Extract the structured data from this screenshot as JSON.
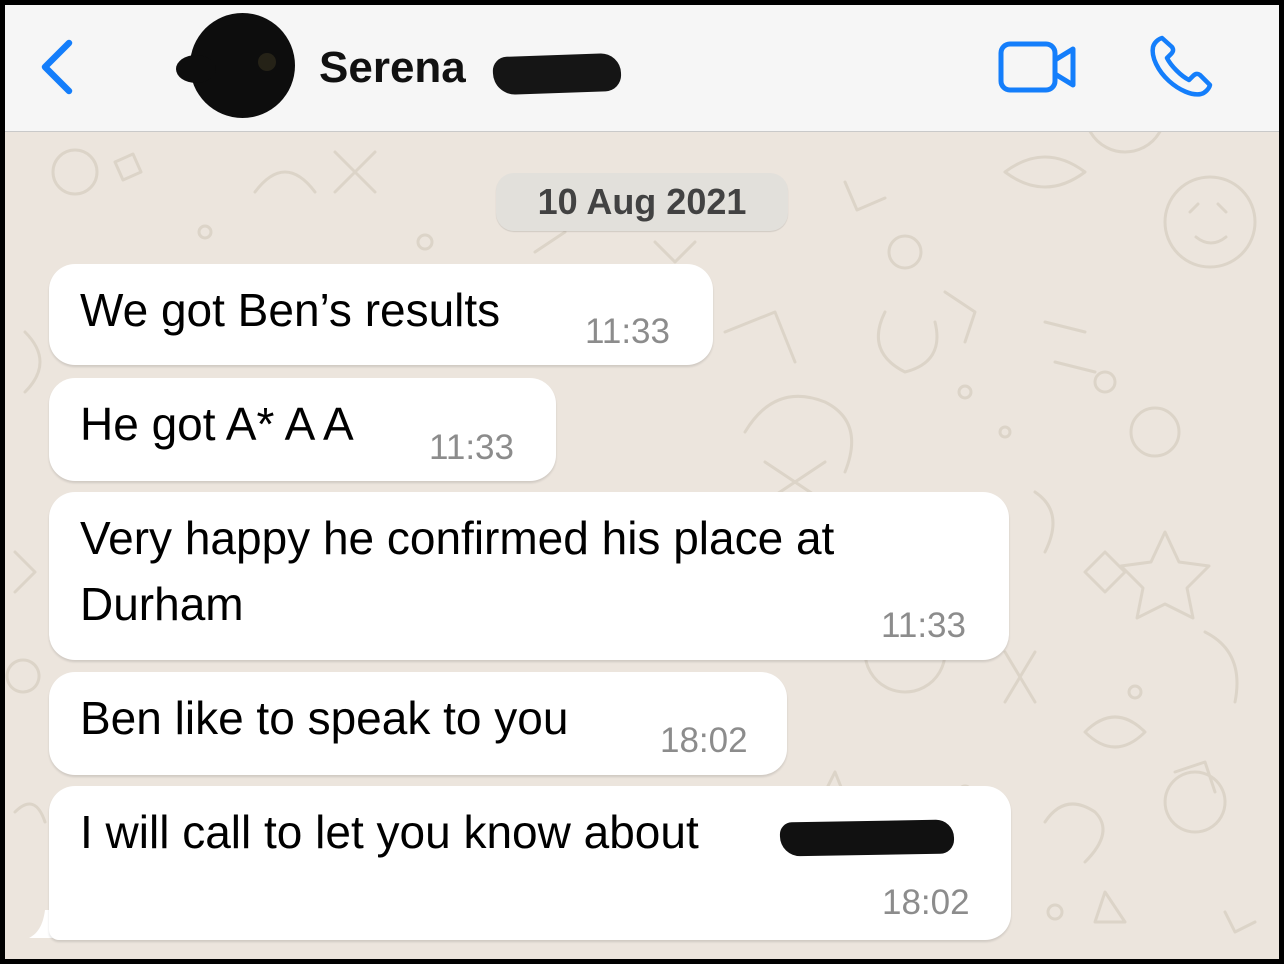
{
  "header": {
    "contact_name": "Serena"
  },
  "date_separator": "10 Aug 2021",
  "messages": [
    {
      "text": "We got Ben’s results",
      "time": "11:33"
    },
    {
      "text": "He got A* A A",
      "time": "11:33"
    },
    {
      "text_line1": "Very happy he confirmed his place at",
      "text_line2": "Durham",
      "time": "11:33"
    },
    {
      "text": "Ben like to speak to you",
      "time": "18:02"
    },
    {
      "text": "I will call to let you know about",
      "time": "18:02"
    }
  ],
  "colors": {
    "accent": "#147EFB",
    "chat_background": "#ECE5DD",
    "bubble": "#FFFFFF",
    "timestamp": "#8C8C8C"
  },
  "icons": [
    "back-chevron-icon",
    "video-call-icon",
    "phone-call-icon"
  ]
}
